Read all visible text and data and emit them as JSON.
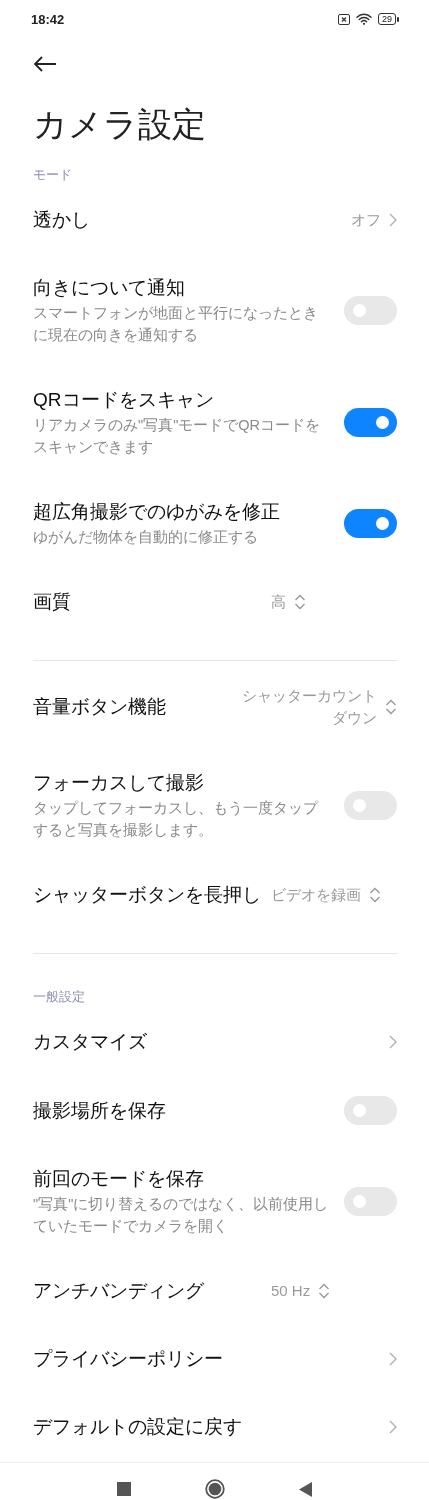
{
  "status_bar": {
    "time": "18:42",
    "battery": "29"
  },
  "title": "カメラ設定",
  "sections": [
    {
      "header": "モード",
      "items": [
        {
          "kind": "link",
          "title": "透かし",
          "value": "オフ"
        },
        {
          "kind": "toggle",
          "title": "向きについて通知",
          "subtitle": "スマートフォンが地面と平行になったときに現在の向きを通知する",
          "on": false
        },
        {
          "kind": "toggle",
          "title": "QRコードをスキャン",
          "subtitle": "リアカメラのみ\"写真\"モードでQRコードをスキャンできます",
          "on": true
        },
        {
          "kind": "toggle",
          "title": "超広角撮影でのゆがみを修正",
          "subtitle": "ゆがんだ物体を自動的に修正する",
          "on": true
        },
        {
          "kind": "select",
          "title": "画質",
          "value": "高"
        }
      ]
    },
    {
      "items": [
        {
          "kind": "select",
          "title": "音量ボタン機能",
          "value": "シャッターカウントダウン"
        },
        {
          "kind": "toggle",
          "title": "フォーカスして撮影",
          "subtitle": "タップしてフォーカスし、もう一度タップすると写真を撮影します。",
          "on": false
        },
        {
          "kind": "select",
          "title": "シャッターボタンを長押し",
          "value": "ビデオを録画"
        }
      ]
    },
    {
      "header": "一般設定",
      "items": [
        {
          "kind": "link",
          "title": "カスタマイズ"
        },
        {
          "kind": "toggle",
          "title": "撮影場所を保存",
          "on": false
        },
        {
          "kind": "toggle",
          "title": "前回のモードを保存",
          "subtitle": "\"写真\"に切り替えるのではなく、以前使用していたモードでカメラを開く",
          "on": false
        },
        {
          "kind": "select",
          "title": "アンチバンディング",
          "value": "50 Hz"
        },
        {
          "kind": "link",
          "title": "プライバシーポリシー"
        },
        {
          "kind": "link",
          "title": "デフォルトの設定に戻す"
        }
      ]
    }
  ]
}
